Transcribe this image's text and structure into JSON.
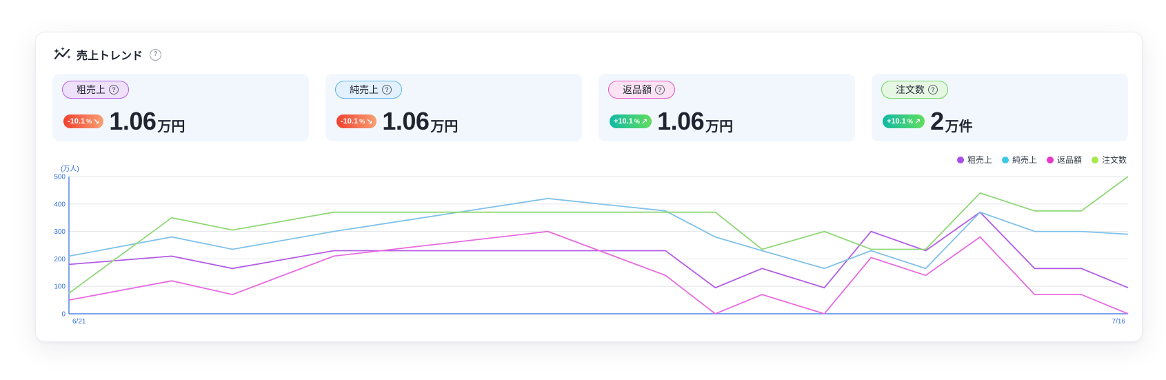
{
  "header": {
    "title": "売上トレンド",
    "icon": "sparkle-trend-icon",
    "help_icon": "question-circle-icon"
  },
  "metrics": [
    {
      "label": "粗売上",
      "change": "-10.1",
      "change_unit": "%",
      "direction": "down",
      "arrow": "↘",
      "value": "1.06",
      "unit": "万円",
      "label_bg": "#f0e1fb",
      "label_border": "#b35be6"
    },
    {
      "label": "純売上",
      "change": "-10.1",
      "change_unit": "%",
      "direction": "down",
      "arrow": "↘",
      "value": "1.06",
      "unit": "万円",
      "label_bg": "#e2f1fd",
      "label_border": "#5bb5e6"
    },
    {
      "label": "返品額",
      "change": "+10.1",
      "change_unit": "%",
      "direction": "up",
      "arrow": "↗",
      "value": "1.06",
      "unit": "万円",
      "label_bg": "#fbe3f4",
      "label_border": "#e653c4"
    },
    {
      "label": "注文数",
      "change": "+10.1",
      "change_unit": "%",
      "direction": "up",
      "arrow": "↗",
      "value": "2",
      "unit": "万件",
      "label_bg": "#e6f7e4",
      "label_border": "#6dd460"
    }
  ],
  "colors": {
    "axis": "#2e6ce0",
    "grid": "#e3e6ea",
    "badge_down_start": "#f2402f",
    "badge_up_start": "#10b9a5"
  },
  "chart_data": {
    "type": "line",
    "ylabel": "(万人)",
    "ylim": [
      0,
      500
    ],
    "y_ticks": [
      0,
      100,
      200,
      300,
      400,
      500
    ],
    "x_labels": [
      "6/21",
      "7/16"
    ],
    "grid": true,
    "legend_position": "top-right",
    "x": [
      0,
      1.32,
      2.1,
      3.4,
      6.15,
      7.66,
      8.3,
      8.9,
      9.7,
      10.3,
      11.0,
      11.7,
      12.4,
      13.0,
      13.6
    ],
    "series": [
      {
        "name": "粗売上",
        "color": "#b35be6",
        "legend_color": "#a64ee8",
        "values": [
          180,
          210,
          165,
          230,
          230,
          230,
          95,
          165,
          95,
          300,
          230,
          370,
          165,
          165,
          95
        ]
      },
      {
        "name": "純売上",
        "color": "#7fc1ea",
        "legend_color": "#3cc9e6",
        "values": [
          210,
          280,
          235,
          300,
          420,
          375,
          280,
          230,
          165,
          230,
          165,
          370,
          300,
          300,
          290
        ]
      },
      {
        "name": "返品額",
        "color": "#e86ae0",
        "legend_color": "#e838c8",
        "values": [
          50,
          120,
          70,
          210,
          300,
          140,
          0,
          70,
          0,
          205,
          140,
          280,
          70,
          70,
          0
        ]
      },
      {
        "name": "注文数",
        "color": "#8fd876",
        "legend_color": "#a8e84a",
        "values": [
          75,
          350,
          305,
          370,
          370,
          370,
          370,
          235,
          300,
          235,
          235,
          440,
          375,
          375,
          500
        ]
      }
    ]
  }
}
